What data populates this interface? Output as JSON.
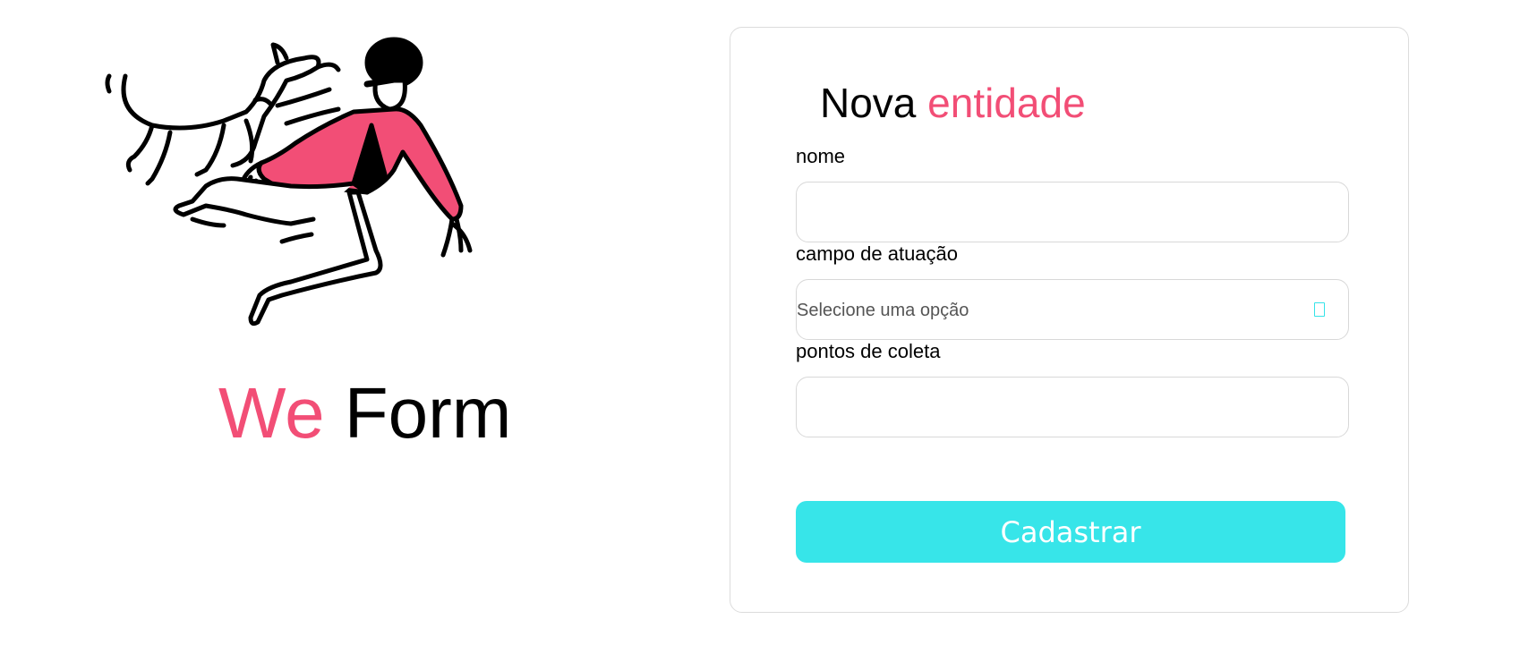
{
  "brand": {
    "title_accent": "We",
    "title_rest": "Form",
    "illustration": "person-running-with-dog-illustration"
  },
  "form": {
    "title_prefix": "Nova",
    "title_accent": "entidade",
    "fields": [
      {
        "label": "nome",
        "value": "",
        "type": "text"
      },
      {
        "label": "campo de atuação",
        "placeholder": "Selecione uma opção",
        "type": "select"
      },
      {
        "label": "pontos de coleta",
        "value": "",
        "type": "text"
      }
    ],
    "submit_label": "Cadastrar"
  },
  "colors": {
    "accent_pink": "#f24e76",
    "button_cyan": "#37e5e9",
    "border": "#d8d8d8"
  }
}
